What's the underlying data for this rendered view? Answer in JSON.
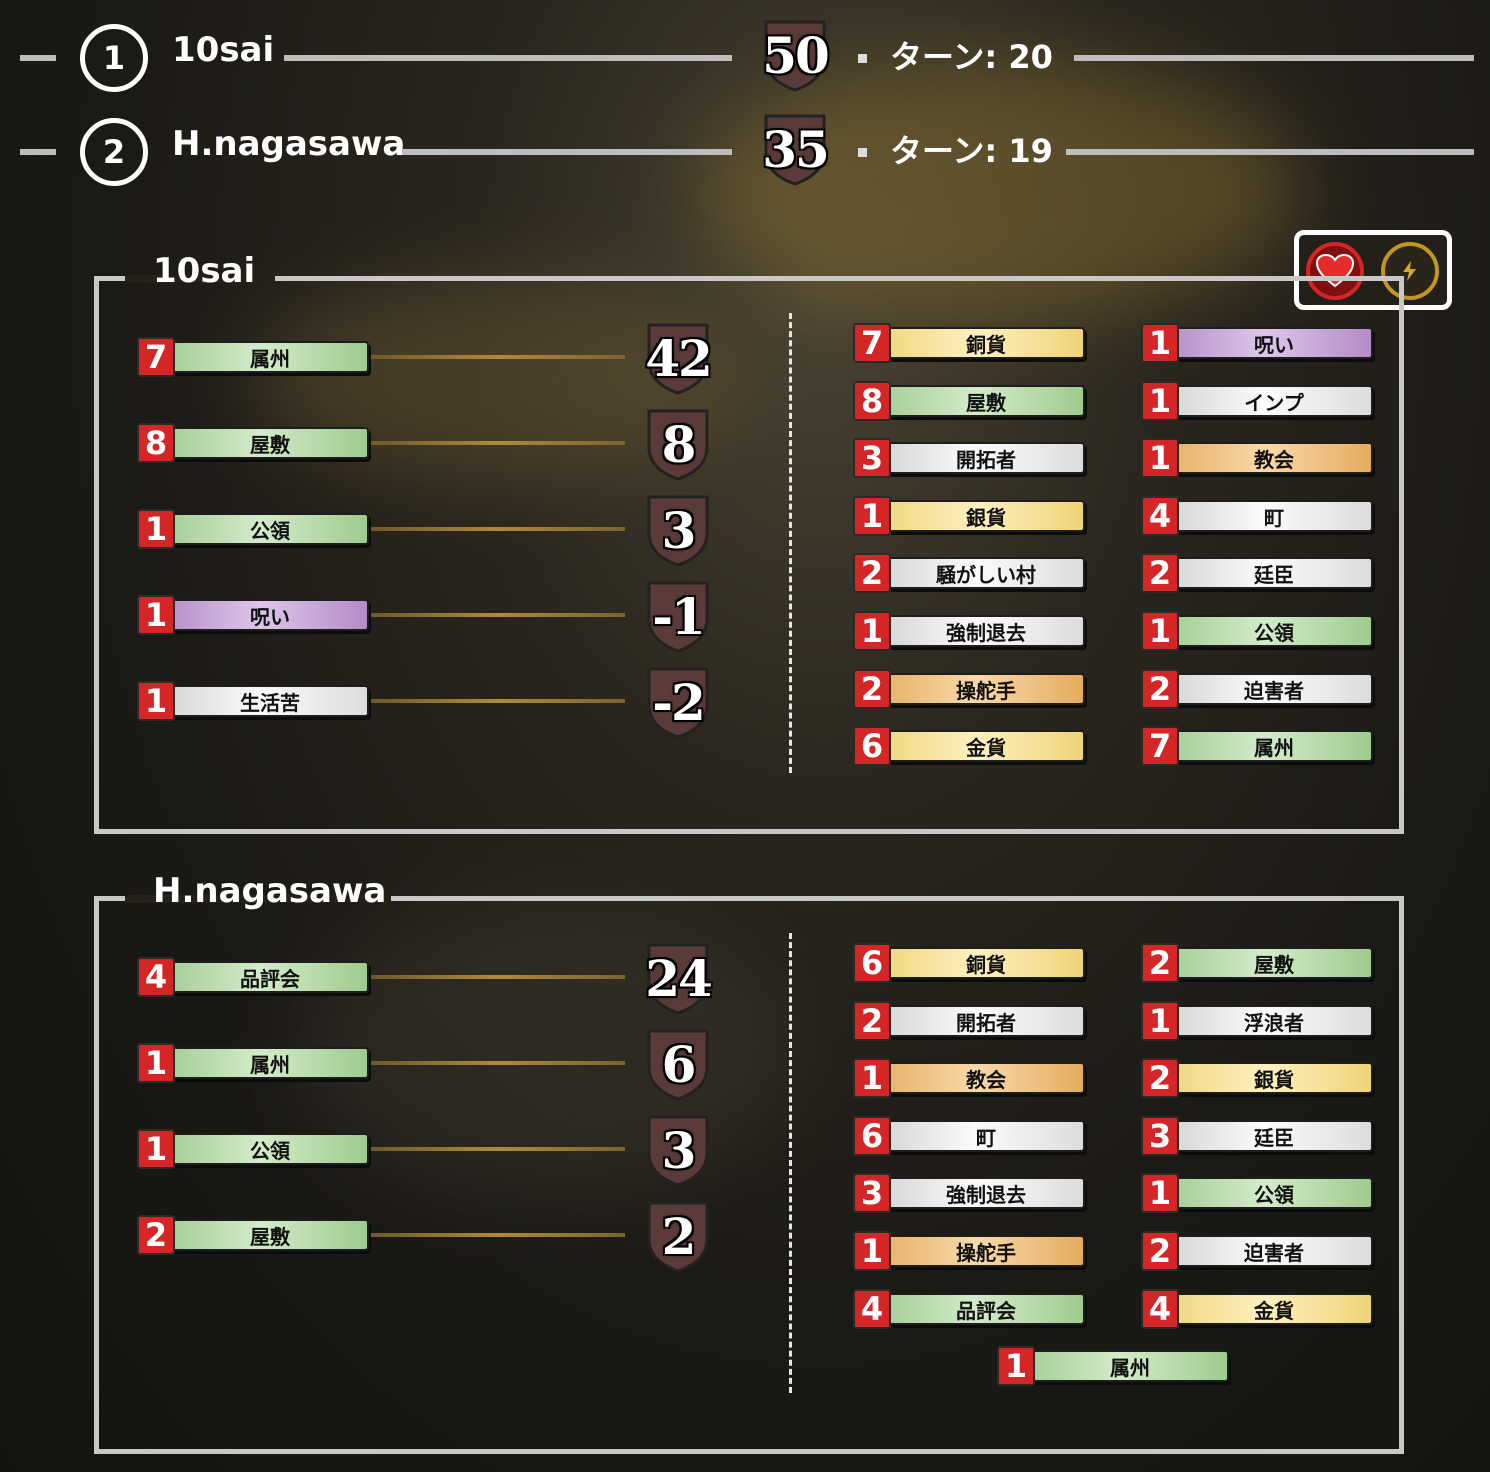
{
  "header": {
    "players": [
      {
        "rank": "1",
        "name": "10sai",
        "score": "50",
        "turn": "ターン: 20"
      },
      {
        "rank": "2",
        "name": "H.nagasawa",
        "score": "35",
        "turn": "ターン: 19"
      }
    ]
  },
  "icons": {
    "heart": "heart-icon",
    "lightning": "lightning-icon"
  },
  "colors": {
    "count_badge": "#d42527",
    "green": "#b9dca9",
    "yellow": "#f7e49c",
    "white": "#f0f0f0",
    "orange": "#eec283",
    "purple": "#c8a6d9",
    "border": "#c8c8c8"
  },
  "panels": [
    {
      "name": "10sai",
      "scores": [
        {
          "count": "7",
          "card": "属州",
          "color": "green",
          "points": "42"
        },
        {
          "count": "8",
          "card": "屋敷",
          "color": "green",
          "points": "8"
        },
        {
          "count": "1",
          "card": "公領",
          "color": "green",
          "points": "3"
        },
        {
          "count": "1",
          "card": "呪い",
          "color": "purple",
          "points": "-1"
        },
        {
          "count": "1",
          "card": "生活苦",
          "color": "white",
          "points": "-2"
        }
      ],
      "deck": [
        {
          "count": "7",
          "card": "銅貨",
          "color": "yellow"
        },
        {
          "count": "1",
          "card": "呪い",
          "color": "purple"
        },
        {
          "count": "8",
          "card": "屋敷",
          "color": "green"
        },
        {
          "count": "1",
          "card": "インプ",
          "color": "white"
        },
        {
          "count": "3",
          "card": "開拓者",
          "color": "white"
        },
        {
          "count": "1",
          "card": "教会",
          "color": "orange"
        },
        {
          "count": "1",
          "card": "銀貨",
          "color": "yellow"
        },
        {
          "count": "4",
          "card": "町",
          "color": "white"
        },
        {
          "count": "2",
          "card": "騒がしい村",
          "color": "white"
        },
        {
          "count": "2",
          "card": "廷臣",
          "color": "white"
        },
        {
          "count": "1",
          "card": "強制退去",
          "color": "white"
        },
        {
          "count": "1",
          "card": "公領",
          "color": "green"
        },
        {
          "count": "2",
          "card": "操舵手",
          "color": "orange"
        },
        {
          "count": "2",
          "card": "迫害者",
          "color": "white"
        },
        {
          "count": "6",
          "card": "金貨",
          "color": "yellow"
        },
        {
          "count": "7",
          "card": "属州",
          "color": "green"
        }
      ]
    },
    {
      "name": "H.nagasawa",
      "scores": [
        {
          "count": "4",
          "card": "品評会",
          "color": "green",
          "points": "24"
        },
        {
          "count": "1",
          "card": "属州",
          "color": "green",
          "points": "6"
        },
        {
          "count": "1",
          "card": "公領",
          "color": "green",
          "points": "3"
        },
        {
          "count": "2",
          "card": "屋敷",
          "color": "green",
          "points": "2"
        }
      ],
      "deck": [
        {
          "count": "6",
          "card": "銅貨",
          "color": "yellow"
        },
        {
          "count": "2",
          "card": "屋敷",
          "color": "green"
        },
        {
          "count": "2",
          "card": "開拓者",
          "color": "white"
        },
        {
          "count": "1",
          "card": "浮浪者",
          "color": "white"
        },
        {
          "count": "1",
          "card": "教会",
          "color": "orange"
        },
        {
          "count": "2",
          "card": "銀貨",
          "color": "yellow"
        },
        {
          "count": "6",
          "card": "町",
          "color": "white"
        },
        {
          "count": "3",
          "card": "廷臣",
          "color": "white"
        },
        {
          "count": "3",
          "card": "強制退去",
          "color": "white"
        },
        {
          "count": "1",
          "card": "公領",
          "color": "green"
        },
        {
          "count": "1",
          "card": "操舵手",
          "color": "orange"
        },
        {
          "count": "2",
          "card": "迫害者",
          "color": "white"
        },
        {
          "count": "4",
          "card": "品評会",
          "color": "green"
        },
        {
          "count": "4",
          "card": "金貨",
          "color": "yellow"
        },
        {
          "count": "1",
          "card": "属州",
          "color": "green"
        }
      ]
    }
  ]
}
